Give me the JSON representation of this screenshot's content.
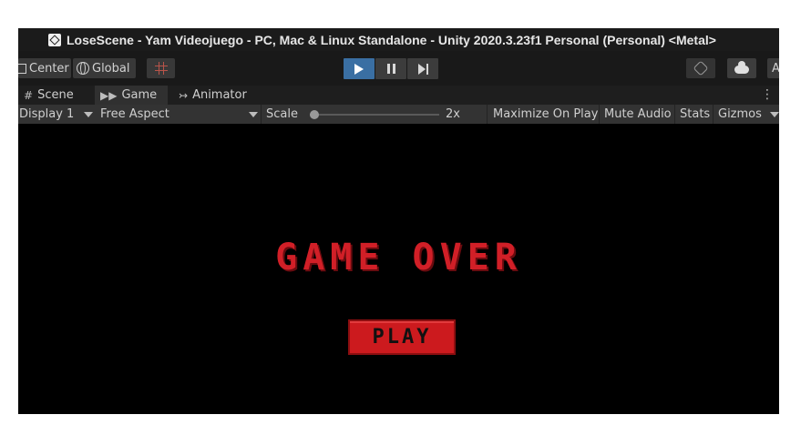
{
  "window_title": "LoseScene - Yam Videojuego - PC, Mac & Linux Standalone - Unity 2020.3.23f1 Personal (Personal) <Metal>",
  "toolbar": {
    "pivot_label": "Center",
    "space_label": "Global",
    "account_label": "A",
    "icons": [
      "pivot-icon",
      "globe-icon",
      "grid-snap-icon",
      "play-icon",
      "pause-icon",
      "step-icon",
      "collab-icon",
      "cloud-icon"
    ],
    "play_color": "#3a6fa3"
  },
  "tabs": [
    {
      "label": "Scene",
      "icon": "#"
    },
    {
      "label": "Game",
      "icon": "▶▶"
    },
    {
      "label": "Animator",
      "icon": "↣"
    }
  ],
  "gamebar": {
    "display": "Display 1",
    "aspect": "Free Aspect",
    "scale_label": "Scale",
    "scale_value": "2x",
    "maximize": "Maximize On Play",
    "mute": "Mute Audio",
    "stats": "Stats",
    "gizmos": "Gizmos"
  },
  "game": {
    "title": "GAME OVER",
    "button_label": "PLAY",
    "accent_color": "#d11f27"
  }
}
